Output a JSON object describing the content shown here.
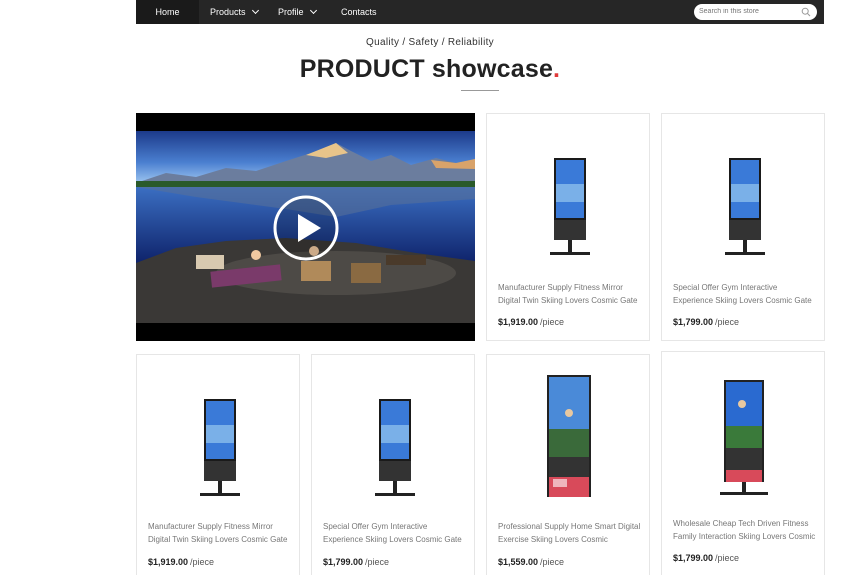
{
  "nav": {
    "items": [
      {
        "label": "Home"
      },
      {
        "label": "Products"
      },
      {
        "label": "Profile"
      },
      {
        "label": "Contacts"
      }
    ],
    "search_placeholder": "Search in this store"
  },
  "header": {
    "tagline": "Quality / Safety / Reliability",
    "title": "PRODUCT showcase",
    "title_dot": "."
  },
  "colors": {
    "nav_bg": "#262626",
    "accent": "#e03a3a"
  },
  "products": [
    {
      "name": "Manufacturer Supply Fitness Mirror Digital Twin Skiing Lovers Cosmic Gate",
      "price": "$1,919.00",
      "unit": "/piece",
      "icon": "kiosk-stand-image"
    },
    {
      "name": "Special Offer Gym Interactive Experience Skiing Lovers Cosmic Gate",
      "price": "$1,799.00",
      "unit": "/piece",
      "icon": "kiosk-stand-image"
    },
    {
      "name": "Manufacturer Supply Fitness Mirror Digital Twin Skiing Lovers Cosmic Gate",
      "price": "$1,919.00",
      "unit": "/piece",
      "icon": "kiosk-stand-image"
    },
    {
      "name": "Special Offer Gym Interactive Experience Skiing Lovers Cosmic Gate",
      "price": "$1,799.00",
      "unit": "/piece",
      "icon": "kiosk-stand-image"
    },
    {
      "name": "Professional Supply Home Smart Digital Exercise Skiing Lovers Cosmic",
      "price": "$1,559.00",
      "unit": "/piece",
      "icon": "floor-mirror-image"
    },
    {
      "name": "Wholesale Cheap Tech Driven Fitness Family Interaction Skiing Lovers Cosmic",
      "price": "$1,799.00",
      "unit": "/piece",
      "icon": "floor-mirror-image"
    }
  ]
}
